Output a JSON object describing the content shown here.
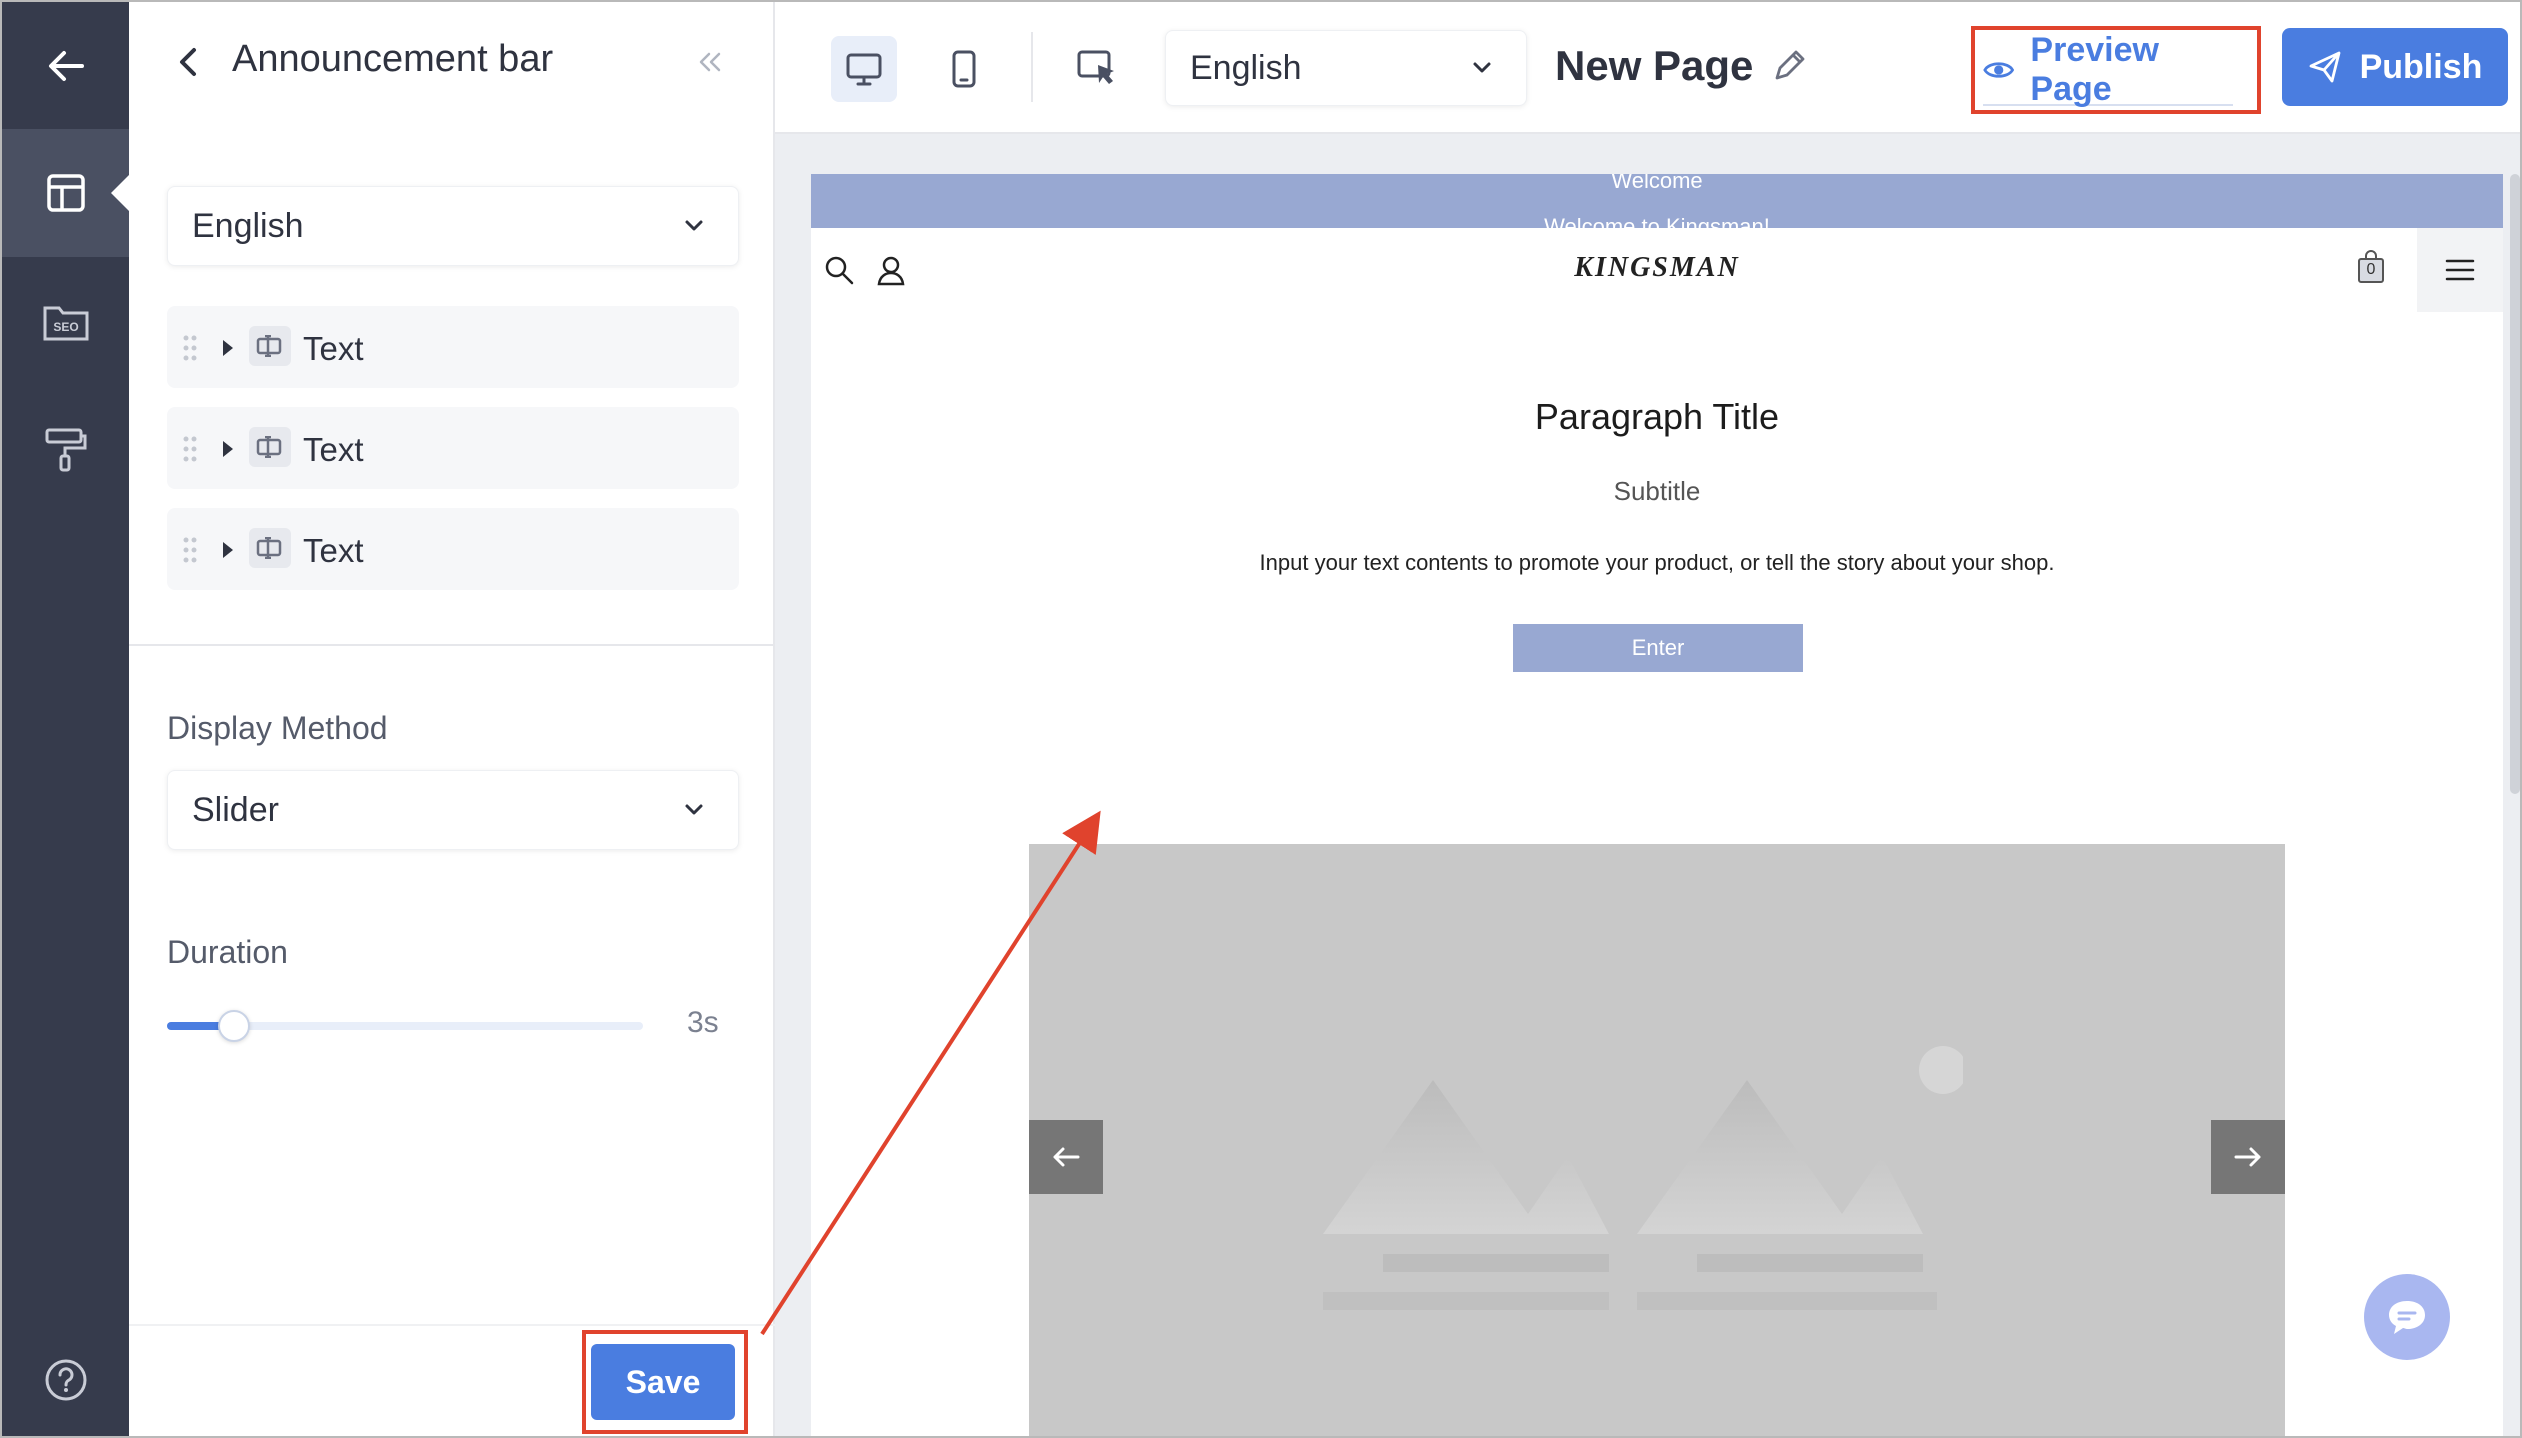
{
  "panel": {
    "title": "Announcement bar",
    "language": "English",
    "items": [
      {
        "label": "Text"
      },
      {
        "label": "Text"
      },
      {
        "label": "Text"
      }
    ],
    "display_method": {
      "label": "Display Method",
      "value": "Slider"
    },
    "duration": {
      "label": "Duration",
      "value": "3s",
      "level": 0.14
    },
    "save_label": "Save"
  },
  "toolbar": {
    "language": "English",
    "page_name": "New Page",
    "preview_label": "Preview Page",
    "publish_label": "Publish"
  },
  "preview": {
    "announcement": [
      "Welcome",
      "Welcome to Kingsman!"
    ],
    "logo": "KINGSMAN",
    "cart_count": "0",
    "paragraph_title": "Paragraph Title",
    "subtitle": "Subtitle",
    "body": "Input your text contents to promote your product, or tell the story about your shop.",
    "button": "Enter"
  },
  "colors": {
    "rail": "#363b4c",
    "accent": "#4a7de0",
    "annotation": "#e0432d",
    "announcement_bg": "#98a8d2"
  },
  "icons": [
    "back-arrow-icon",
    "layout-icon",
    "seo-folder-icon",
    "paint-roller-icon",
    "help-icon",
    "desktop-icon",
    "mobile-icon",
    "select-element-icon",
    "pencil-icon",
    "eye-icon",
    "send-icon",
    "chat-icon"
  ]
}
